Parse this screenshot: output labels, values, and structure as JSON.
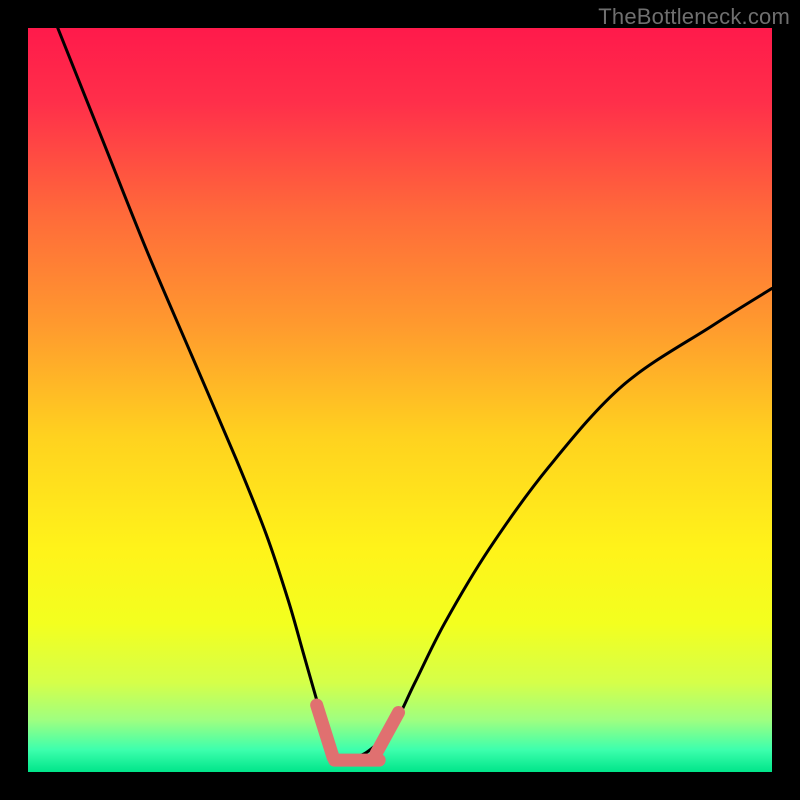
{
  "watermark": "TheBottleneck.com",
  "chart_data": {
    "type": "line",
    "title": "",
    "xlabel": "",
    "ylabel": "",
    "xlim": [
      0,
      100
    ],
    "ylim": [
      0,
      100
    ],
    "series": [
      {
        "name": "bottleneck-curve",
        "x": [
          4,
          10,
          16,
          22,
          28,
          32,
          35,
          37,
          39,
          40.5,
          42,
          44,
          46,
          49,
          52,
          56,
          62,
          70,
          80,
          92,
          100
        ],
        "values": [
          100,
          85,
          70,
          56,
          42,
          32,
          23,
          16,
          9,
          4,
          2,
          2,
          3,
          6,
          12,
          20,
          30,
          41,
          52,
          60,
          65
        ]
      }
    ],
    "markers": [
      {
        "name": "left-marker",
        "x": [
          38.8,
          41.0
        ],
        "y": [
          9.0,
          2.0
        ]
      },
      {
        "name": "bottom-marker",
        "x": [
          41.2,
          47.2
        ],
        "y": [
          1.6,
          1.6
        ]
      },
      {
        "name": "right-marker",
        "x": [
          46.8,
          49.8
        ],
        "y": [
          2.5,
          8.0
        ]
      }
    ],
    "gradient_stops": [
      {
        "offset": 0.0,
        "color": "#ff1a4b"
      },
      {
        "offset": 0.1,
        "color": "#ff2f4a"
      },
      {
        "offset": 0.25,
        "color": "#ff6a3a"
      },
      {
        "offset": 0.4,
        "color": "#ff9a2e"
      },
      {
        "offset": 0.55,
        "color": "#ffd21f"
      },
      {
        "offset": 0.7,
        "color": "#fff31a"
      },
      {
        "offset": 0.8,
        "color": "#f3ff1f"
      },
      {
        "offset": 0.88,
        "color": "#d5ff49"
      },
      {
        "offset": 0.93,
        "color": "#9fff80"
      },
      {
        "offset": 0.97,
        "color": "#3dffad"
      },
      {
        "offset": 1.0,
        "color": "#00e58a"
      }
    ],
    "curve_stroke": "#000000",
    "marker_stroke": "#e07070"
  }
}
